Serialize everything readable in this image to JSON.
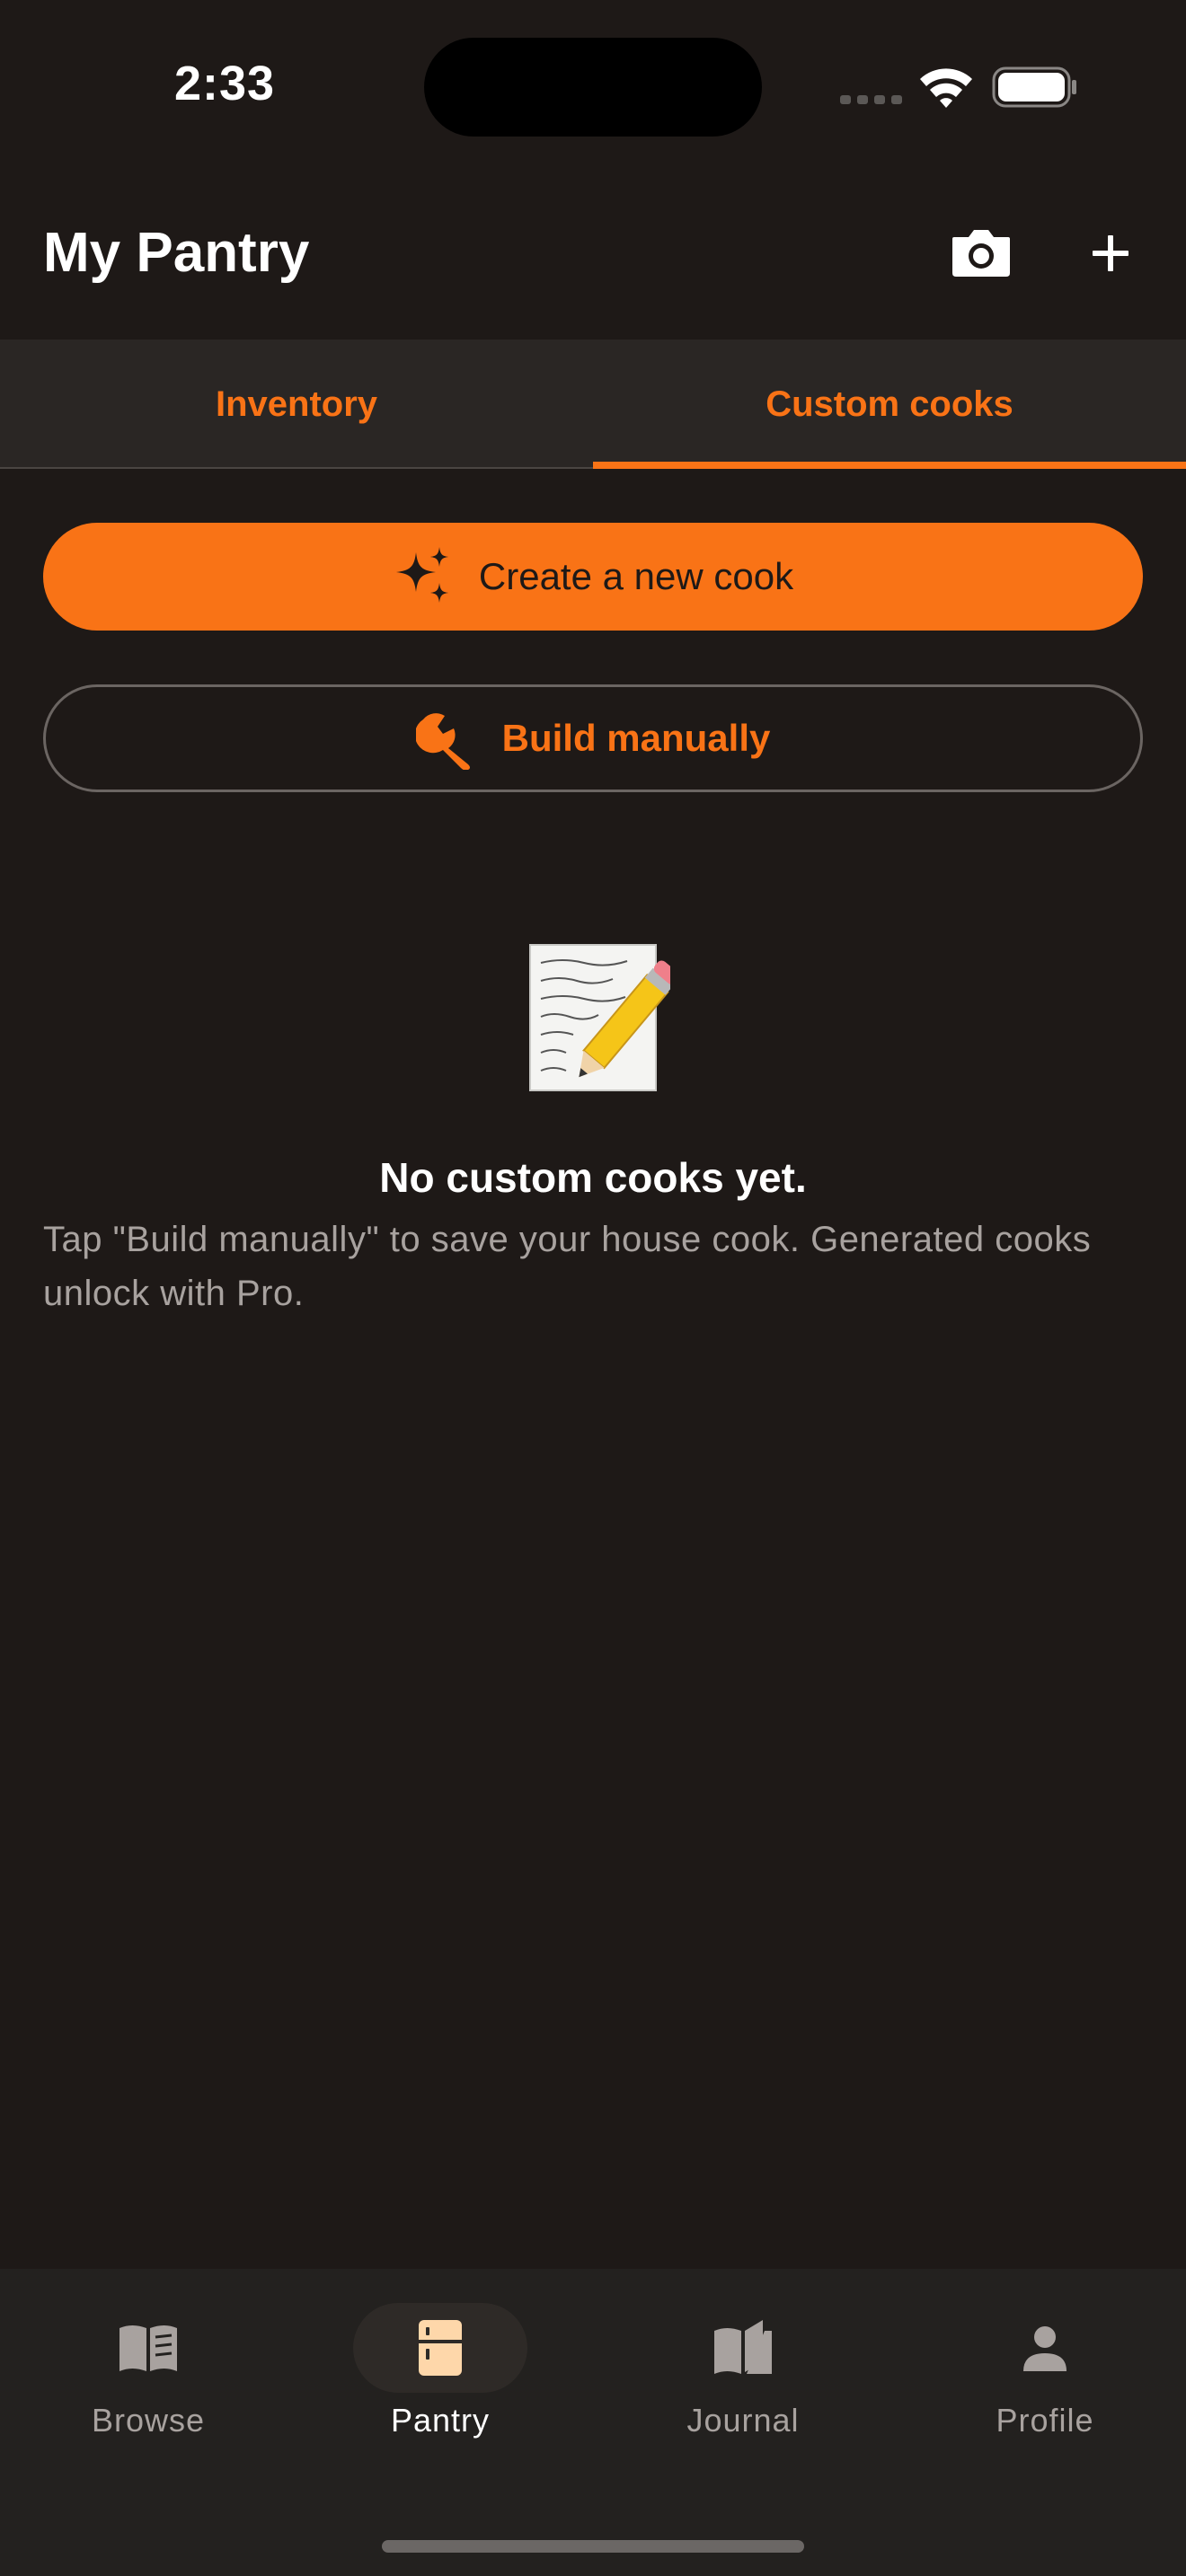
{
  "status_bar": {
    "time": "2:33"
  },
  "header": {
    "title": "My Pantry"
  },
  "tabs": [
    {
      "label": "Inventory",
      "active": false
    },
    {
      "label": "Custom cooks",
      "active": true
    }
  ],
  "actions": {
    "create_label": "Create a new cook",
    "build_label": "Build manually"
  },
  "empty_state": {
    "title": "No custom cooks yet.",
    "description": "Tap \"Build manually\" to save your house cook. Generated cooks unlock with Pro."
  },
  "bottom_nav": [
    {
      "label": "Browse",
      "icon": "book-open-icon",
      "active": false
    },
    {
      "label": "Pantry",
      "icon": "fridge-icon",
      "active": true
    },
    {
      "label": "Journal",
      "icon": "journal-icon",
      "active": false
    },
    {
      "label": "Profile",
      "icon": "person-icon",
      "active": false
    }
  ],
  "colors": {
    "background": "#1e1917",
    "accent": "#f97316",
    "tab_bar": "#2a2624",
    "nav_bar": "#23211f",
    "muted_text": "#a8a29f"
  }
}
